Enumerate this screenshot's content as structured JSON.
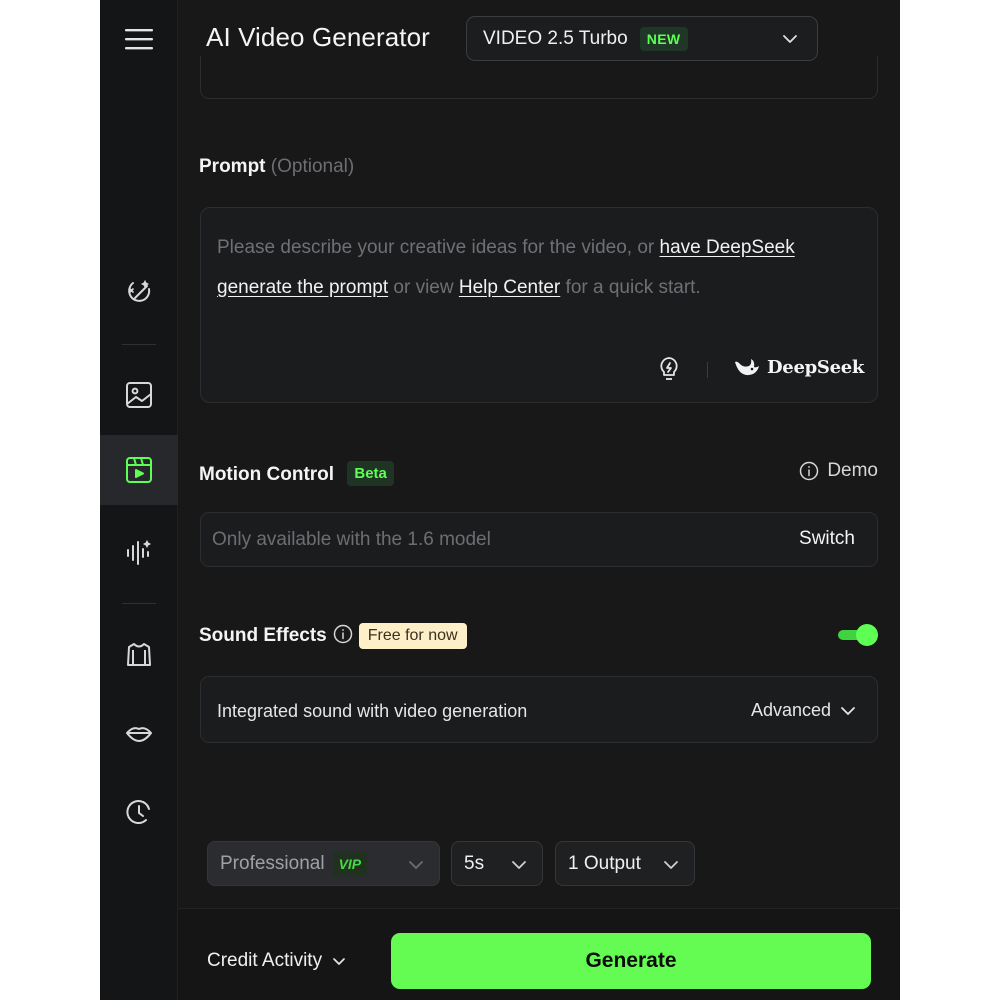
{
  "header": {
    "title": "AI Video Generator",
    "model_name": "VIDEO 2.5 Turbo",
    "model_badge": "NEW"
  },
  "sidebar": {
    "items": [
      {
        "name": "magic-wand-icon"
      },
      {
        "name": "image-icon"
      },
      {
        "name": "video-icon",
        "active": true
      },
      {
        "name": "audio-wave-icon"
      },
      {
        "name": "shirt-icon"
      },
      {
        "name": "lips-icon"
      },
      {
        "name": "history-icon"
      }
    ],
    "active_color": "#5dff54"
  },
  "prompt": {
    "label": "Prompt",
    "optional": "(Optional)",
    "text_1": "Please describe your creative ideas for the video, or ",
    "link_1": "have DeepSeek generate the prompt",
    "text_2": " or view ",
    "link_2": "Help Center",
    "text_3": " for a quick start.",
    "deepseek_label": "DeepSeek"
  },
  "motion": {
    "label": "Motion Control",
    "badge": "Beta",
    "demo": "Demo",
    "placeholder": "Only available with the 1.6 model",
    "switch_label": "Switch"
  },
  "sound": {
    "label": "Sound Effects",
    "badge": "Free for now",
    "enabled": true,
    "description": "Integrated sound with video generation",
    "advanced": "Advanced"
  },
  "options": {
    "mode": "Professional",
    "mode_badge": "VIP",
    "duration": "5s",
    "outputs": "1 Output"
  },
  "footer": {
    "credit_activity": "Credit Activity",
    "generate": "Generate"
  },
  "colors": {
    "accent": "#64fb52",
    "background": "#181819",
    "free_badge": "#fdefc7"
  }
}
